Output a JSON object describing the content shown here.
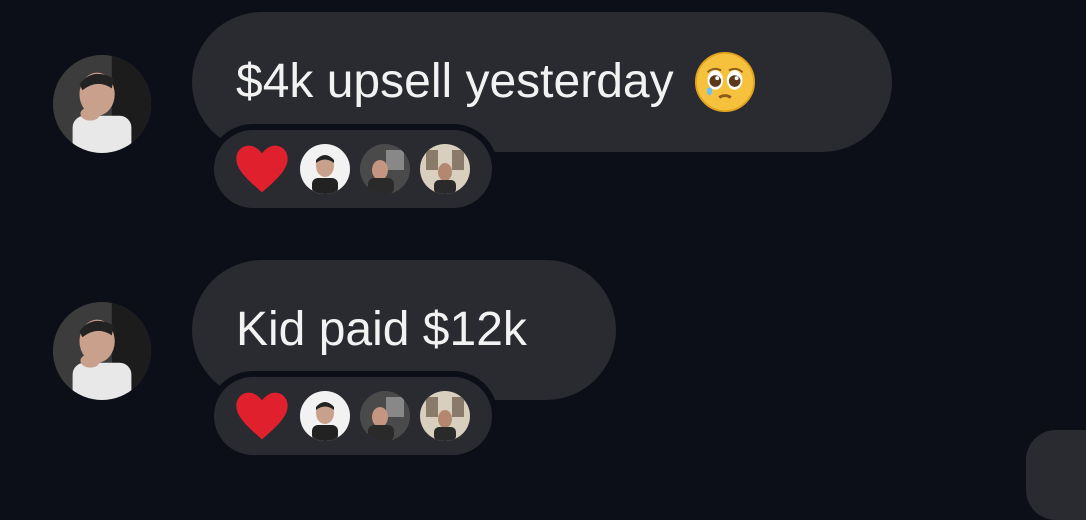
{
  "messages": [
    {
      "text": "$4k upsell yesterday",
      "emoji": "pleading-face-emoji",
      "reactions": {
        "icon": "heart-emoji",
        "reactors": [
          "reactor-avatar-1",
          "reactor-avatar-2",
          "reactor-avatar-3"
        ]
      }
    },
    {
      "text": "Kid paid $12k",
      "reactions": {
        "icon": "heart-emoji",
        "reactors": [
          "reactor-avatar-1",
          "reactor-avatar-2",
          "reactor-avatar-3"
        ]
      }
    }
  ],
  "colors": {
    "background": "#0c0f18",
    "bubble": "#2a2b30",
    "text": "#f2f2f2",
    "heart": "#e0202d"
  }
}
